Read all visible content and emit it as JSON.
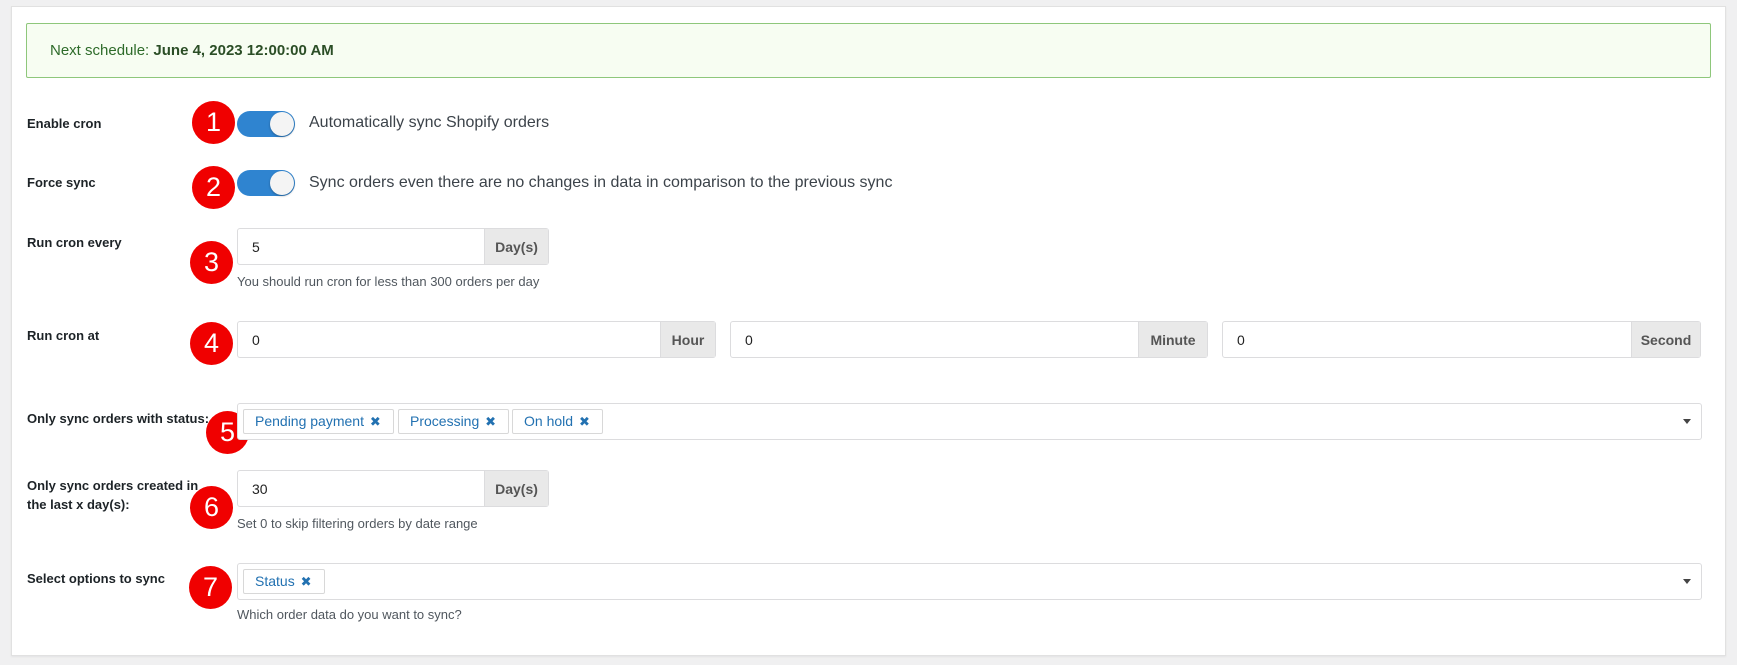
{
  "notice": {
    "prefix": "Next schedule:",
    "value": "June 4, 2023 12:00:00 AM"
  },
  "badges": [
    "1",
    "2",
    "3",
    "4",
    "5",
    "6",
    "7"
  ],
  "enable_cron": {
    "label": "Enable cron",
    "enabled": true,
    "text": "Automatically sync Shopify orders"
  },
  "force_sync": {
    "label": "Force sync",
    "enabled": true,
    "text": "Sync orders even there are no changes in data in comparison to the previous sync"
  },
  "run_every": {
    "label": "Run cron every",
    "value": "5",
    "unit": "Day(s)",
    "help": "You should run cron for less than 300 orders per day"
  },
  "run_at": {
    "label": "Run cron at",
    "hour": {
      "value": "0",
      "unit": "Hour"
    },
    "minute": {
      "value": "0",
      "unit": "Minute"
    },
    "second": {
      "value": "0",
      "unit": "Second"
    }
  },
  "status_filter": {
    "label": "Only sync orders with status:",
    "tags": [
      "Pending payment",
      "Processing",
      "On hold"
    ],
    "remove_glyph": "✖"
  },
  "created_filter": {
    "label_line1": "Only sync orders created in",
    "label_line2": "the last x day(s):",
    "value": "30",
    "unit": "Day(s)",
    "help": "Set 0 to skip filtering orders by date range"
  },
  "sync_options": {
    "label": "Select options to sync",
    "tags": [
      "Status"
    ],
    "help": "Which order data do you want to sync?"
  },
  "colors": {
    "accent": "#2f84d0",
    "badge": "#f00000",
    "tag_text": "#2271b1",
    "notice_border": "#8ec77b"
  }
}
